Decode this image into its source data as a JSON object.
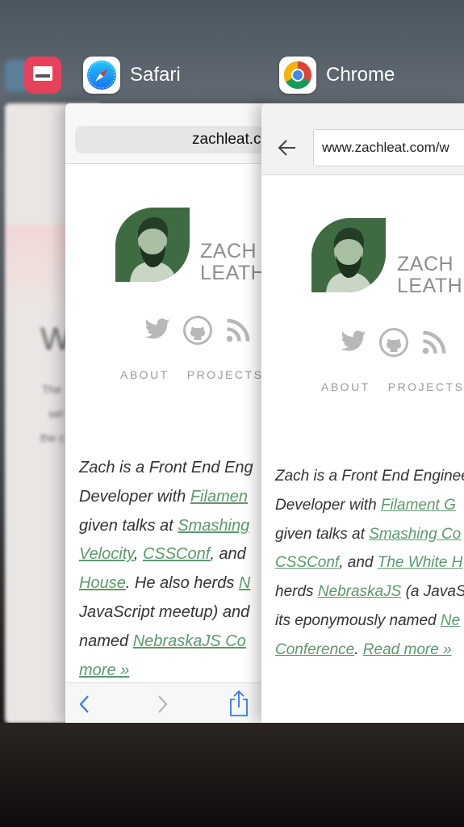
{
  "switcher": {
    "apps": [
      {
        "name": "Safari"
      },
      {
        "name": "Chrome"
      }
    ]
  },
  "background_card": {
    "heading": "W",
    "lines": [
      "The",
      "sel",
      "the c"
    ]
  },
  "safari": {
    "url": "zachleat.c",
    "logo": {
      "line1": "ZACH",
      "line2": "LEATH"
    },
    "nav": {
      "about": "ABOUT",
      "projects": "PROJECTS"
    },
    "bio": [
      {
        "t": "Zach is a Front End Eng"
      },
      {
        "t": "Developer with ",
        "link": "Filamen"
      },
      {
        "t": "given talks at ",
        "link": "Smashing"
      },
      {
        "link": "Velocity",
        "t2": ", ",
        "link2": "CSSConf",
        "t3": ", and"
      },
      {
        "link": "House",
        "t2": ". He also herds ",
        "link2": "N"
      },
      {
        "t": "JavaScript meetup) and"
      },
      {
        "t": "named ",
        "link": "NebraskaJS Co"
      },
      {
        "link": "more »"
      }
    ]
  },
  "chrome": {
    "url": "www.zachleat.com/w",
    "logo": {
      "line1": "ZACH",
      "line2": "LEATHE"
    },
    "nav": {
      "about": "ABOUT",
      "projects": "PROJECTS"
    },
    "bio": [
      {
        "t": "Zach is a Front End Enginee"
      },
      {
        "t": "Developer with ",
        "link": "Filament G"
      },
      {
        "t": "given talks at ",
        "link": "Smashing Co"
      },
      {
        "link": "CSSConf",
        "t2": ", and ",
        "link2": "The White H"
      },
      {
        "t": "herds ",
        "link": "NebraskaJS",
        "t2": " (a JavaS"
      },
      {
        "t": "its eponymously named ",
        "link": "Ne"
      },
      {
        "link": "Conference",
        "t2": ". ",
        "link2": "Read more »"
      }
    ]
  },
  "colors": {
    "accent_green": "#5a9a6b",
    "logo_green": "#3f6b43",
    "ios_blue": "#3478f6"
  }
}
